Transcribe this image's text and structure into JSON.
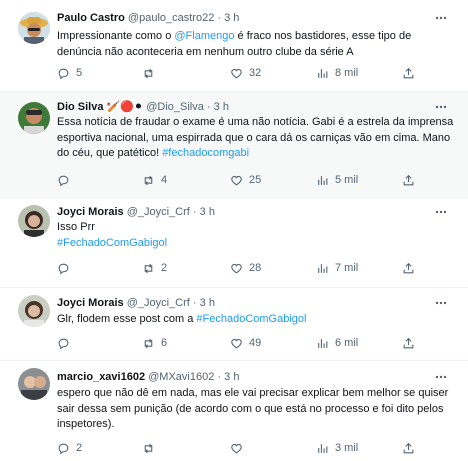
{
  "tweets": [
    {
      "name": "Paulo Castro",
      "name_emoji": "",
      "handle": "@paulo_castro22",
      "dot": "·",
      "time": "3 h",
      "text_parts": [
        {
          "t": "Impressionante como o ",
          "link": false
        },
        {
          "t": "@Flamengo",
          "link": true
        },
        {
          "t": " é fraco nos bastidores, esse tipo de denúncia não aconteceria em nenhum outro clube da série A",
          "link": false
        }
      ],
      "replies": "5",
      "retweets": "",
      "likes": "32",
      "views": "8 mil"
    },
    {
      "name": "Dio Silva",
      "name_emoji": "🏏🔴⚫",
      "handle": "@Dio_Silva",
      "dot": "·",
      "time": "3 h",
      "text_parts": [
        {
          "t": "Essa notícia de fraudar o exame é uma não notícia. Gabi é a estrela da imprensa esportiva nacional, uma espirrada que o cara dá os carniças vão em cima. Mano do céu, que patético! ",
          "link": false
        },
        {
          "t": "#fechadocomgabi",
          "link": true
        }
      ],
      "replies": "",
      "retweets": "4",
      "likes": "25",
      "views": "5 mil"
    },
    {
      "name": "Joyci Morais",
      "name_emoji": "",
      "handle": "@_Joyci_Crf",
      "dot": "·",
      "time": "3 h",
      "text_parts": [
        {
          "t": "Isso Prr",
          "link": false,
          "br": true
        },
        {
          "t": "#FechadoComGabigol",
          "link": true
        }
      ],
      "replies": "",
      "retweets": "2",
      "likes": "28",
      "views": "7 mil"
    },
    {
      "name": "Joyci Morais",
      "name_emoji": "",
      "handle": "@_Joyci_Crf",
      "dot": "·",
      "time": "3 h",
      "text_parts": [
        {
          "t": "Glr, flodem esse post com a ",
          "link": false
        },
        {
          "t": "#FechadoComGabigol",
          "link": true
        }
      ],
      "replies": "",
      "retweets": "6",
      "likes": "49",
      "views": "6 mil"
    },
    {
      "name": "marcio_xavi1602",
      "name_emoji": "",
      "handle": "@MXavi1602",
      "dot": "·",
      "time": "3 h",
      "text_parts": [
        {
          "t": "espero que não dê em nada, mas ele vai precisar explicar bem melhor se quiser sair dessa sem punição (de acordo com o que está no processo e foi dito pelos inspetores).",
          "link": false
        }
      ],
      "replies": "2",
      "retweets": "",
      "likes": "",
      "views": "3 mil"
    }
  ],
  "icons": {
    "reply": "reply-icon",
    "retweet": "retweet-icon",
    "like": "heart-icon",
    "views": "views-icon",
    "share": "share-icon",
    "more": "more-icon"
  },
  "colors": {
    "link": "#1d9bf0",
    "secondary": "#536471",
    "text": "#0f1419",
    "highlight_bg": "#f7f9f9"
  }
}
